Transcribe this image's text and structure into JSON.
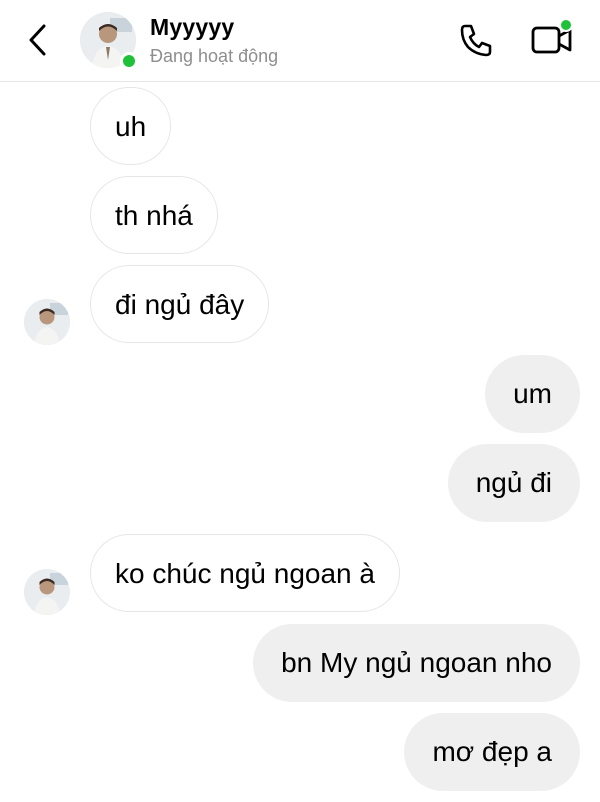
{
  "header": {
    "contact_name": "Myyyyy",
    "status": "Đang hoạt động",
    "online_color": "#1fc13a",
    "icons": [
      "chevron-left-icon",
      "phone-icon",
      "video-icon"
    ]
  },
  "messages": [
    {
      "direction": "in",
      "text": "uh",
      "show_avatar": false
    },
    {
      "direction": "in",
      "text": "th nhá",
      "show_avatar": false
    },
    {
      "direction": "in",
      "text": "đi ngủ đây",
      "show_avatar": true
    },
    {
      "direction": "out",
      "text": "um"
    },
    {
      "direction": "out",
      "text": "ngủ đi"
    },
    {
      "direction": "in",
      "text": "ko chúc ngủ ngoan à",
      "show_avatar": true
    },
    {
      "direction": "out",
      "text": "bn My ngủ ngoan nho"
    },
    {
      "direction": "out",
      "text": "mơ đẹp a"
    }
  ],
  "colors": {
    "incoming_bubble": "#ffffff",
    "outgoing_bubble": "#efefef",
    "secondary_text": "#8e8e8e"
  }
}
